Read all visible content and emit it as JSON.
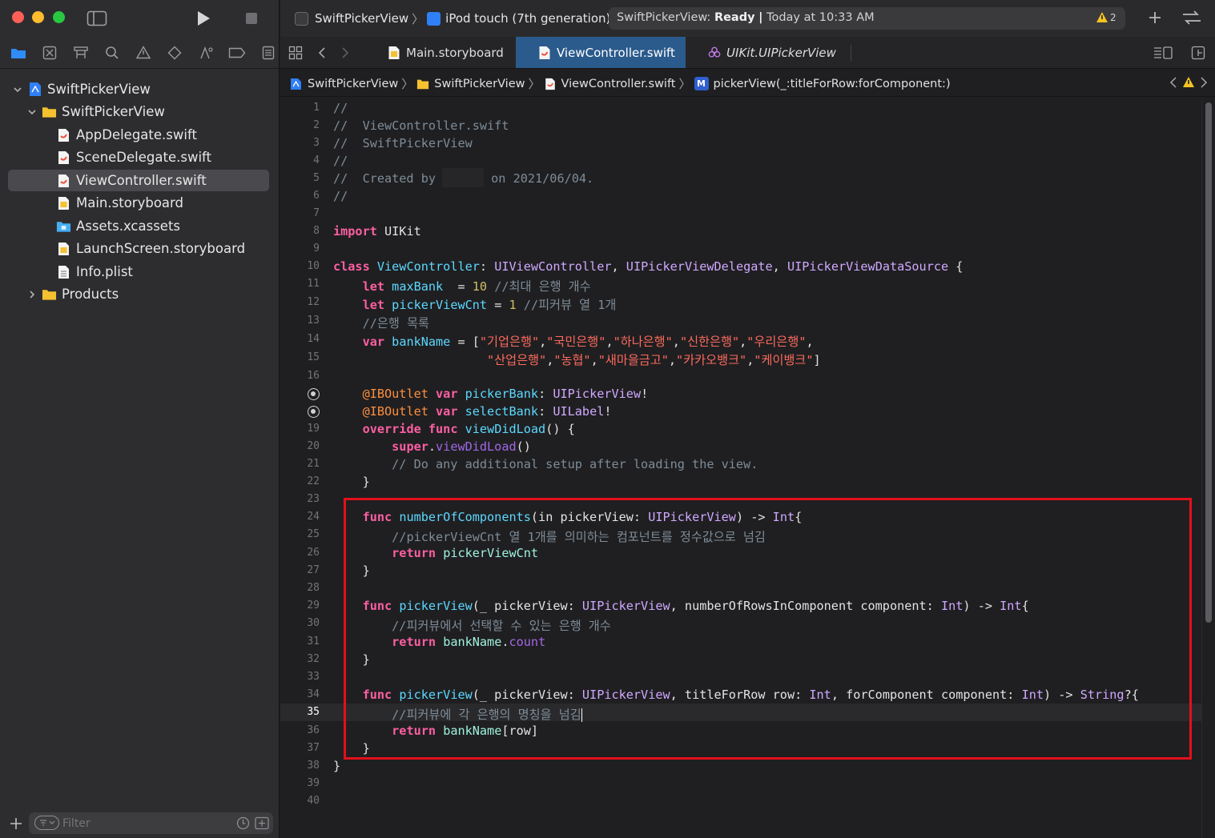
{
  "titlebar": {
    "scheme_project": "SwiftPickerView",
    "scheme_device": "iPod touch (7th generation)",
    "activity_project": "SwiftPickerView:",
    "activity_status": "Ready",
    "activity_time": "Today at 10:33 AM",
    "warning_count": "2"
  },
  "tabs": [
    {
      "label": "Main.storyboard",
      "active": false
    },
    {
      "label": "ViewController.swift",
      "active": true
    },
    {
      "label": "UIKit.UIPickerView",
      "active": false
    }
  ],
  "jumpbar": {
    "crumbs": [
      "SwiftPickerView",
      "SwiftPickerView",
      "ViewController.swift",
      "pickerView(_:titleForRow:forComponent:)"
    ],
    "method_badge": "M"
  },
  "navigator": {
    "items": [
      {
        "label": "SwiftPickerView",
        "kind": "project",
        "expanded": true
      },
      {
        "label": "SwiftPickerView",
        "kind": "folder",
        "expanded": true
      },
      {
        "label": "AppDelegate.swift",
        "kind": "swift"
      },
      {
        "label": "SceneDelegate.swift",
        "kind": "swift"
      },
      {
        "label": "ViewController.swift",
        "kind": "swift",
        "selected": true
      },
      {
        "label": "Main.storyboard",
        "kind": "storyboard"
      },
      {
        "label": "Assets.xcassets",
        "kind": "assets"
      },
      {
        "label": "LaunchScreen.storyboard",
        "kind": "storyboard"
      },
      {
        "label": "Info.plist",
        "kind": "plist"
      },
      {
        "label": "Products",
        "kind": "folder",
        "expanded": false
      }
    ],
    "filter_placeholder": "Filter"
  },
  "editor": {
    "current_line": 35,
    "line_numbers": [
      "1",
      "2",
      "3",
      "4",
      "5",
      "6",
      "7",
      "8",
      "9",
      "10",
      "11",
      "12",
      "13",
      "14",
      "15",
      "16",
      "17",
      "18",
      "19",
      "20",
      "21",
      "22",
      "23",
      "24",
      "25",
      "26",
      "27",
      "28",
      "29",
      "30",
      "31",
      "32",
      "33",
      "34",
      "35",
      "36",
      "37",
      "38",
      "39",
      "40"
    ],
    "text": {
      "l1": "//",
      "l2": "//  ViewController.swift",
      "l3": "//  SwiftPickerView",
      "l4": "//",
      "l5a": "//  Created by",
      "l5b": " on 2021/06/04.",
      "l6": "//",
      "l8a": "import",
      "l8b": " UIKit",
      "l10a": "class",
      "l10b": "ViewController",
      "l10c": "UIViewController",
      "l10d": "UIPickerViewDelegate",
      "l10e": "UIPickerViewDataSource",
      "l11a": "let",
      "l11b": "maxBank",
      "l11c": "10",
      "l11d": "//최대 은행 개수",
      "l12a": "let",
      "l12b": "pickerViewCnt",
      "l12c": "1",
      "l12d": "//피커뷰 열 1개",
      "l13": "//은행 목록",
      "l14a": "var",
      "l14b": "bankName",
      "l14s": [
        "\"기업은행\"",
        "\"국민은행\"",
        "\"하나은행\"",
        "\"신한은행\"",
        "\"우리은행\""
      ],
      "l15s": [
        "\"산업은행\"",
        "\"농협\"",
        "\"새마을금고\"",
        "\"카카오뱅크\"",
        "\"케이뱅크\""
      ],
      "l17a": "@IBOutlet",
      "l17b": "var",
      "l17c": "pickerBank",
      "l17d": "UIPickerView",
      "l18a": "@IBOutlet",
      "l18b": "var",
      "l18c": "selectBank",
      "l18d": "UILabel",
      "l19a": "override",
      "l19b": "func",
      "l19c": "viewDidLoad",
      "l20a": "super",
      "l20b": "viewDidLoad",
      "l21": "// Do any additional setup after loading the view.",
      "l24a": "func",
      "l24b": "numberOfComponents",
      "l24c": "UIPickerView",
      "l24d": "Int",
      "l25": "//pickerViewCnt 열 1개를 의미하는 컴포넌트를 정수값으로 넘김",
      "l26a": "return",
      "l26b": "pickerViewCnt",
      "l29a": "func",
      "l29b": "pickerView",
      "l29c": "UIPickerView",
      "l29d": "Int",
      "l29e": "Int",
      "l30": "//피커뷰에서 선택할 수 있는 은행 개수",
      "l31a": "return",
      "l31b": "bankName",
      "l31c": "count",
      "l34a": "func",
      "l34b": "pickerView",
      "l34c": "UIPickerView",
      "l34d": "Int",
      "l34e": "Int",
      "l34f": "String",
      "l35": "//피커뷰에 각 은행의 명칭을 넘김",
      "l36a": "return",
      "l36b": "bankName"
    }
  },
  "colors": {
    "accent_tab": "#2b5a8c",
    "highlight_box": "#e3101b",
    "keyword": "#fc5fa3",
    "comment": "#7f8c98",
    "string": "#fc6a5d"
  }
}
